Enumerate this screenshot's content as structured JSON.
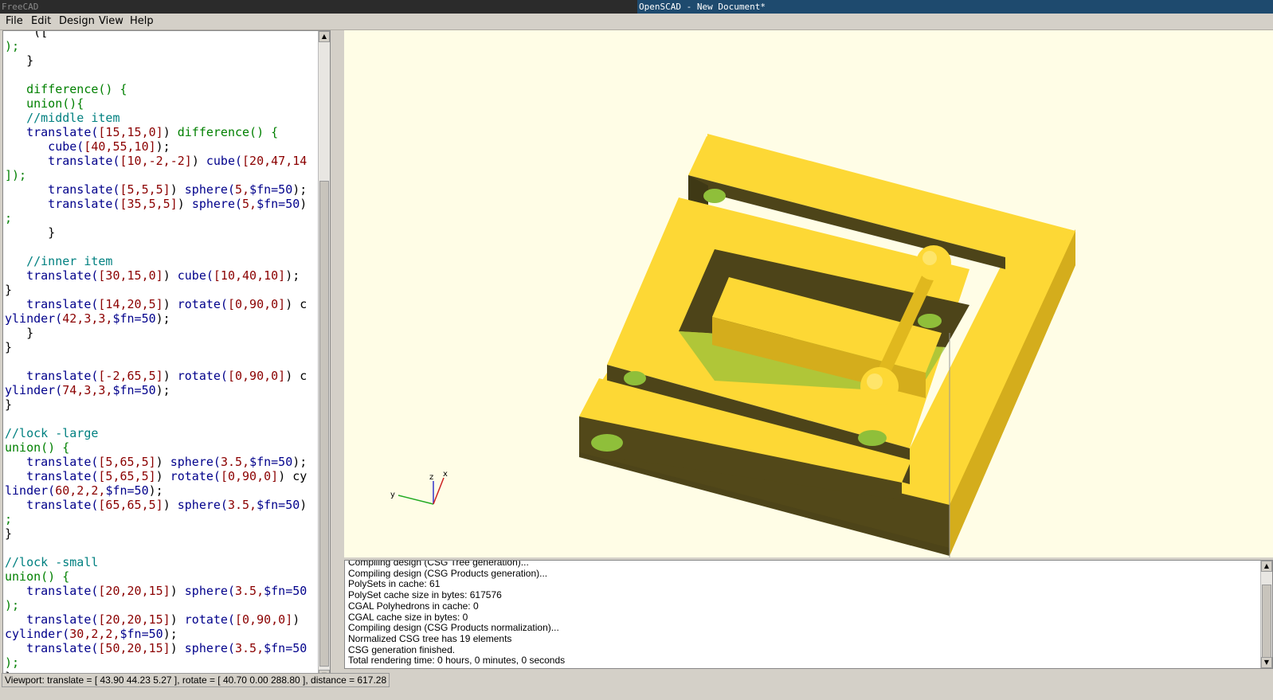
{
  "taskbar": {
    "left_title": "FreeCAD",
    "right_title": "OpenSCAD - New Document*"
  },
  "menubar": {
    "items": [
      "File",
      "Edit",
      "Design",
      "View",
      "Help"
    ]
  },
  "editor": {
    "lines": [
      [
        [
          "    ([",
          ""
        ],
        [
          "",
          "fn"
        ]
      ],
      [
        [
          ");",
          "kw"
        ]
      ],
      [
        [
          "   }",
          ""
        ]
      ],
      [
        [
          "",
          ""
        ]
      ],
      [
        [
          "   difference() {",
          "kw"
        ]
      ],
      [
        [
          "   union(){",
          "kw"
        ]
      ],
      [
        [
          "   //middle item",
          "cm"
        ]
      ],
      [
        [
          "   translate(",
          "fn"
        ],
        [
          "[15,15,0]",
          "num"
        ],
        [
          ") ",
          ""
        ],
        [
          "difference() {",
          "kw"
        ]
      ],
      [
        [
          "      cube(",
          "fn"
        ],
        [
          "[40,55,10]",
          "num"
        ],
        [
          ");",
          ""
        ]
      ],
      [
        [
          "      translate(",
          "fn"
        ],
        [
          "[10,-2,-2]",
          "num"
        ],
        [
          ") ",
          ""
        ],
        [
          "cube(",
          "fn"
        ],
        [
          "[20,47,14",
          "num"
        ]
      ],
      [
        [
          "]);",
          "kw"
        ]
      ],
      [
        [
          "      translate(",
          "fn"
        ],
        [
          "[5,5,5]",
          "num"
        ],
        [
          ") ",
          ""
        ],
        [
          "sphere(",
          "fn"
        ],
        [
          "5,",
          "num"
        ],
        [
          "$fn=50",
          "fn"
        ],
        [
          ");",
          ""
        ]
      ],
      [
        [
          "      translate(",
          "fn"
        ],
        [
          "[35,5,5]",
          "num"
        ],
        [
          ") ",
          ""
        ],
        [
          "sphere(",
          "fn"
        ],
        [
          "5,",
          "num"
        ],
        [
          "$fn=50",
          "fn"
        ],
        [
          ")",
          ""
        ]
      ],
      [
        [
          ";",
          "kw"
        ]
      ],
      [
        [
          "      }",
          ""
        ]
      ],
      [
        [
          "",
          ""
        ]
      ],
      [
        [
          "   //inner item",
          "cm"
        ]
      ],
      [
        [
          "   translate(",
          "fn"
        ],
        [
          "[30,15,0]",
          "num"
        ],
        [
          ") ",
          ""
        ],
        [
          "cube(",
          "fn"
        ],
        [
          "[10,40,10]",
          "num"
        ],
        [
          ");",
          ""
        ]
      ],
      [
        [
          "}",
          ""
        ]
      ],
      [
        [
          "   translate(",
          "fn"
        ],
        [
          "[14,20,5]",
          "num"
        ],
        [
          ") ",
          ""
        ],
        [
          "rotate(",
          "fn"
        ],
        [
          "[0,90,0]",
          "num"
        ],
        [
          ") c",
          ""
        ]
      ],
      [
        [
          "ylinder(",
          "fn"
        ],
        [
          "42,3,3,",
          "num"
        ],
        [
          "$fn=50",
          "fn"
        ],
        [
          ");",
          ""
        ]
      ],
      [
        [
          "   }",
          ""
        ]
      ],
      [
        [
          "}",
          ""
        ]
      ],
      [
        [
          "",
          ""
        ]
      ],
      [
        [
          "   translate(",
          "fn"
        ],
        [
          "[-2,65,5]",
          "num"
        ],
        [
          ") ",
          ""
        ],
        [
          "rotate(",
          "fn"
        ],
        [
          "[0,90,0]",
          "num"
        ],
        [
          ") c",
          ""
        ]
      ],
      [
        [
          "ylinder(",
          "fn"
        ],
        [
          "74,3,3,",
          "num"
        ],
        [
          "$fn=50",
          "fn"
        ],
        [
          ");",
          ""
        ]
      ],
      [
        [
          "}",
          ""
        ]
      ],
      [
        [
          "",
          ""
        ]
      ],
      [
        [
          "//lock -large",
          "cm"
        ]
      ],
      [
        [
          "union() {",
          "kw"
        ]
      ],
      [
        [
          "   translate(",
          "fn"
        ],
        [
          "[5,65,5]",
          "num"
        ],
        [
          ") ",
          ""
        ],
        [
          "sphere(",
          "fn"
        ],
        [
          "3.5,",
          "num"
        ],
        [
          "$fn=50",
          "fn"
        ],
        [
          ");",
          ""
        ]
      ],
      [
        [
          "   translate(",
          "fn"
        ],
        [
          "[5,65,5]",
          "num"
        ],
        [
          ") ",
          ""
        ],
        [
          "rotate(",
          "fn"
        ],
        [
          "[0,90,0]",
          "num"
        ],
        [
          ") cy",
          ""
        ]
      ],
      [
        [
          "linder(",
          "fn"
        ],
        [
          "60,2,2,",
          "num"
        ],
        [
          "$fn=50",
          "fn"
        ],
        [
          ");",
          ""
        ]
      ],
      [
        [
          "   translate(",
          "fn"
        ],
        [
          "[65,65,5]",
          "num"
        ],
        [
          ") ",
          ""
        ],
        [
          "sphere(",
          "fn"
        ],
        [
          "3.5,",
          "num"
        ],
        [
          "$fn=50",
          "fn"
        ],
        [
          ")",
          ""
        ]
      ],
      [
        [
          ";",
          "kw"
        ]
      ],
      [
        [
          "}",
          ""
        ]
      ],
      [
        [
          "",
          ""
        ]
      ],
      [
        [
          "//lock -small",
          "cm"
        ]
      ],
      [
        [
          "union() {",
          "kw"
        ]
      ],
      [
        [
          "   translate(",
          "fn"
        ],
        [
          "[20,20,15]",
          "num"
        ],
        [
          ") ",
          ""
        ],
        [
          "sphere(",
          "fn"
        ],
        [
          "3.5,",
          "num"
        ],
        [
          "$fn=50",
          "fn"
        ]
      ],
      [
        [
          ");",
          "kw"
        ]
      ],
      [
        [
          "   translate(",
          "fn"
        ],
        [
          "[20,20,15]",
          "num"
        ],
        [
          ") ",
          ""
        ],
        [
          "rotate(",
          "fn"
        ],
        [
          "[0,90,0]",
          "num"
        ],
        [
          ")",
          ""
        ]
      ],
      [
        [
          "cylinder(",
          "fn"
        ],
        [
          "30,2,2,",
          "num"
        ],
        [
          "$fn=50",
          "fn"
        ],
        [
          ");",
          ""
        ]
      ],
      [
        [
          "   translate(",
          "fn"
        ],
        [
          "[50,20,15]",
          "num"
        ],
        [
          ") ",
          ""
        ],
        [
          "sphere(",
          "fn"
        ],
        [
          "3.5,",
          "num"
        ],
        [
          "$fn=50",
          "fn"
        ]
      ],
      [
        [
          ");",
          "kw"
        ]
      ],
      [
        [
          "}",
          ""
        ]
      ]
    ]
  },
  "viewport": {
    "axes": {
      "x": "x",
      "y": "y",
      "z": "z"
    },
    "colors": {
      "background": "#fffde6",
      "face_top": "#fdd835",
      "face_side": "#4d4419",
      "face_inner": "#8fbf3a"
    }
  },
  "console": {
    "lines": [
      "Compiling design (CSG Tree generation)...",
      "Compiling design (CSG Products generation)...",
      "PolySets in cache: 61",
      "PolySet cache size in bytes: 617576",
      "CGAL Polyhedrons in cache: 0",
      "CGAL cache size in bytes: 0",
      "Compiling design (CSG Products normalization)...",
      "Normalized CSG tree has 19 elements",
      "CSG generation finished.",
      "Total rendering time: 0 hours, 0 minutes, 0 seconds"
    ]
  },
  "statusbar": {
    "text": "Viewport: translate = [ 43.90 44.23 5.27 ], rotate = [ 40.70 0.00 288.80 ], distance = 617.28"
  }
}
